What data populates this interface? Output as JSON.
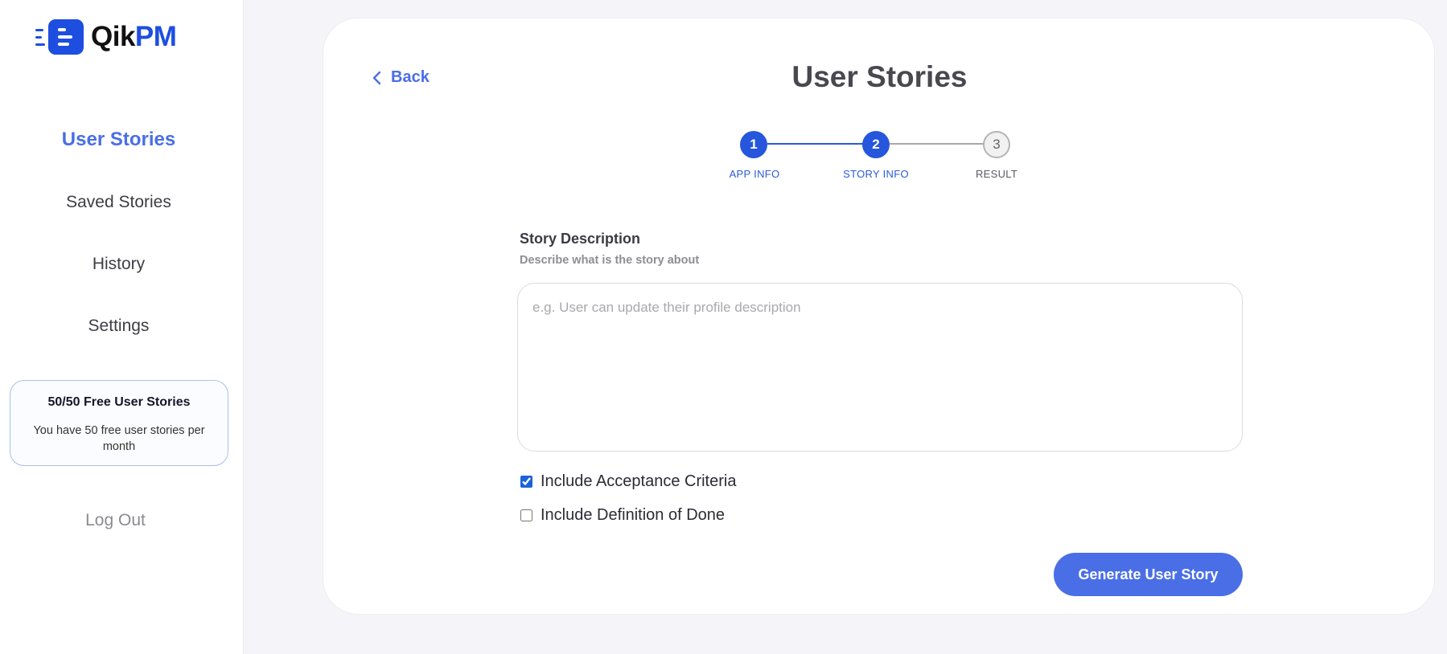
{
  "brand": {
    "name_part1": "Qik",
    "name_part2": "PM",
    "accent_color": "#1d4ee0"
  },
  "sidebar": {
    "nav": [
      {
        "label": "User Stories",
        "active": true
      },
      {
        "label": "Saved Stories",
        "active": false
      },
      {
        "label": "History",
        "active": false
      },
      {
        "label": "Settings",
        "active": false
      }
    ],
    "plan_card": {
      "title": "50/50 Free User Stories",
      "text": "You have 50 free user stories per month"
    },
    "logout_label": "Log Out"
  },
  "main": {
    "back_label": "Back",
    "back_icon": "chevron-left-icon",
    "title": "User Stories",
    "stepper": {
      "steps": [
        {
          "number": "1",
          "label": "APP INFO",
          "state": "done"
        },
        {
          "number": "2",
          "label": "STORY INFO",
          "state": "current"
        },
        {
          "number": "3",
          "label": "RESULT",
          "state": "pending"
        }
      ],
      "active_color": "#2556dc"
    },
    "form": {
      "field_label": "Story Description",
      "field_help": "Describe what is the story about",
      "textarea_value": "",
      "textarea_placeholder": "e.g. User can update their profile description",
      "checkboxes": [
        {
          "label": "Include Acceptance Criteria",
          "checked": true
        },
        {
          "label": "Include Definition of Done",
          "checked": false
        }
      ],
      "submit_label": "Generate User Story",
      "submit_color": "#4a6ee6"
    }
  }
}
